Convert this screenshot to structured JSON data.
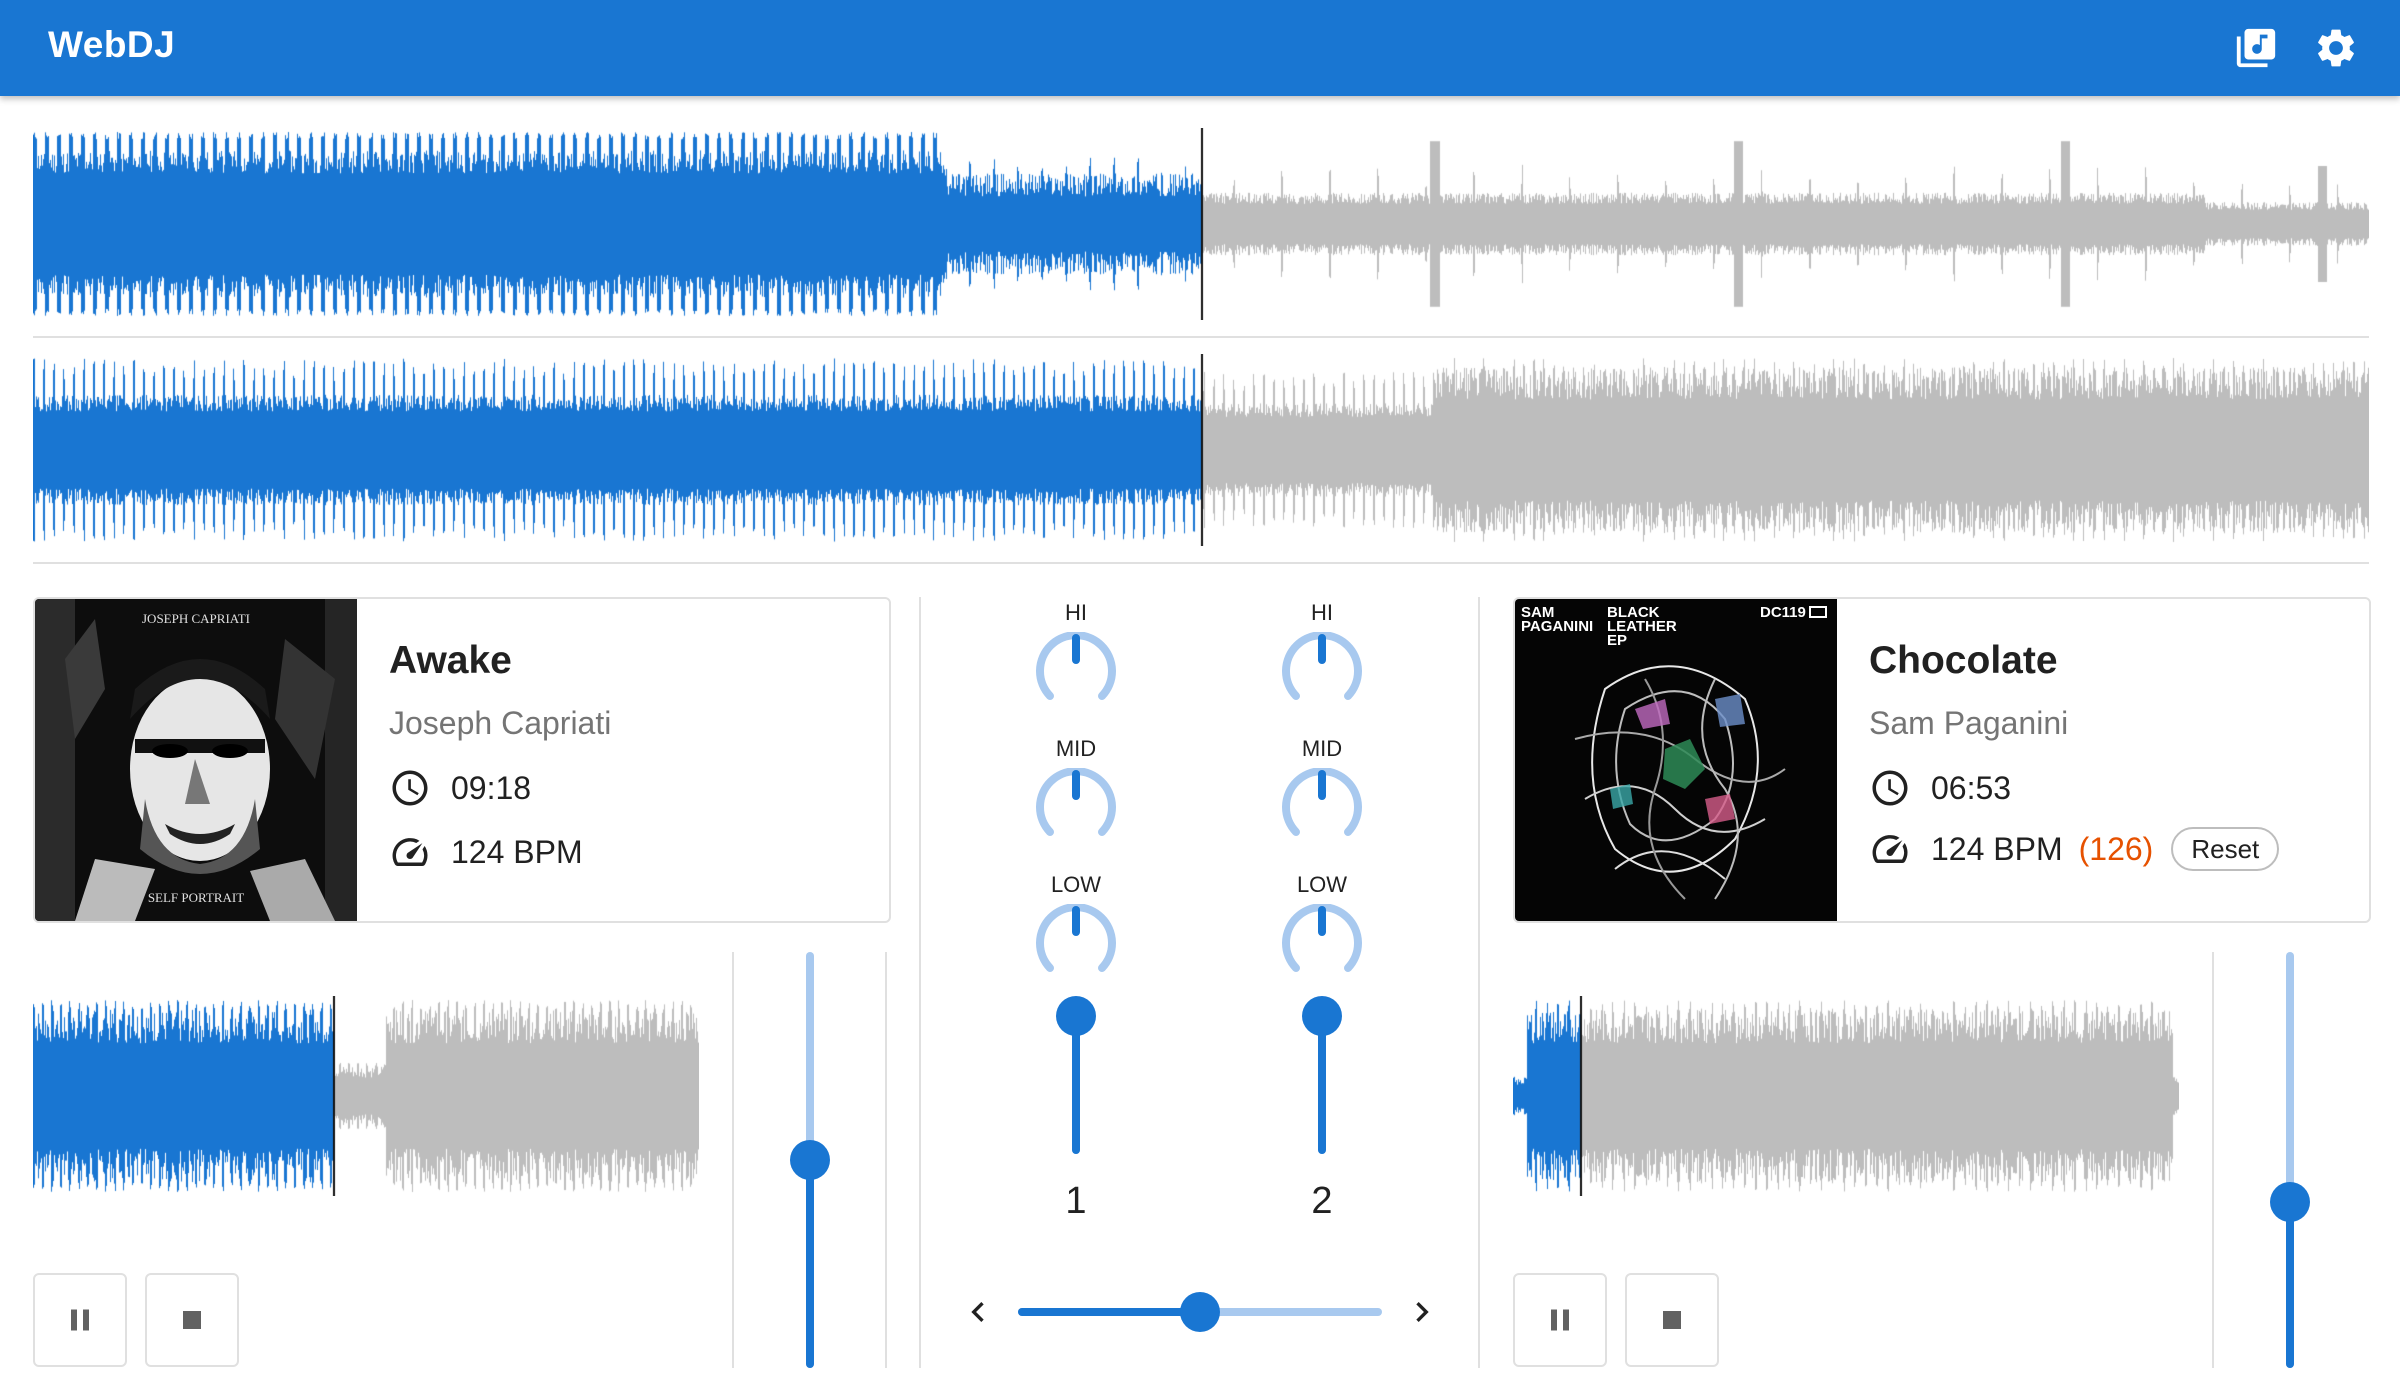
{
  "app": {
    "title": "WebDJ"
  },
  "toolbar": {
    "library_icon": "music-library-icon",
    "settings_icon": "gear-icon"
  },
  "colors": {
    "accent": "#1976d2",
    "accent_light": "#a8c9ef",
    "unplayed_wave": "#bdbdbd",
    "pitch_text": "#e65100"
  },
  "deck1": {
    "title": "Awake",
    "artist": "Joseph Capriati",
    "duration": "09:18",
    "bpm": "124 BPM",
    "cover_text_top": "JOSEPH CAPRIATI",
    "cover_text_bottom": "SELF PORTRAIT",
    "played_fraction": 0.5,
    "preview_played_fraction": 0.45,
    "tempo_level": 0.5
  },
  "deck2": {
    "title": "Chocolate",
    "artist": "Sam Paganini",
    "duration": "06:53",
    "bpm": "124 BPM",
    "pitch_bpm": "(126)",
    "reset_label": "Reset",
    "cover_text_artist": "SAM PAGANINI",
    "cover_text_release": "BLACK LEATHER EP",
    "cover_text_code": "DC119",
    "played_fraction": 0.5,
    "preview_played_fraction": 0.1,
    "tempo_level": 0.4
  },
  "mixer": {
    "eq_labels": [
      "HI",
      "MID",
      "LOW"
    ],
    "channels": [
      {
        "label": "1",
        "volume_level": 1.0
      },
      {
        "label": "2",
        "volume_level": 1.0
      }
    ],
    "crossfader_position": 0.5
  }
}
